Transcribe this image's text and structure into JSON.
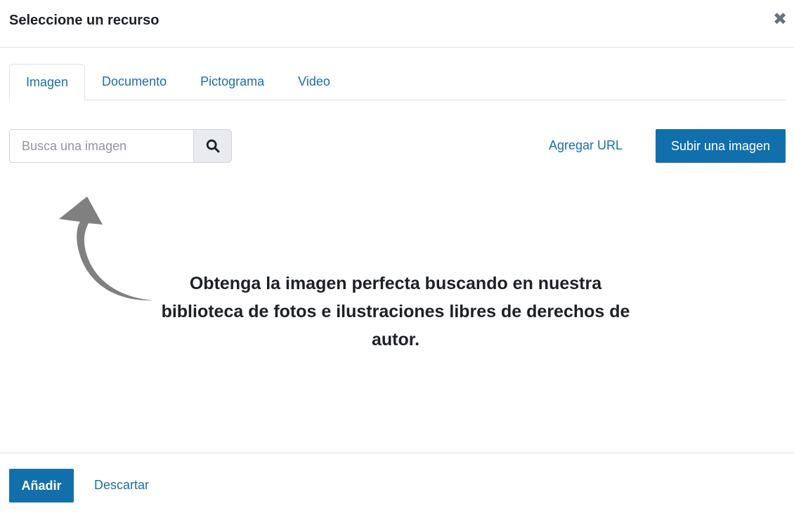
{
  "modal": {
    "title": "Seleccione un recurso",
    "close_icon": "close-icon"
  },
  "tabs": [
    {
      "label": "Imagen",
      "active": true
    },
    {
      "label": "Documento",
      "active": false
    },
    {
      "label": "Pictograma",
      "active": false
    },
    {
      "label": "Video",
      "active": false
    }
  ],
  "search": {
    "placeholder": "Busca una imagen",
    "value": "",
    "icon": "search-icon"
  },
  "actions": {
    "add_url_label": "Agregar URL",
    "upload_label": "Subir una imagen"
  },
  "hint": {
    "text": "Obtenga la imagen perfecta buscando en nuestra biblioteca de fotos e ilustraciones libres de derechos de autor.",
    "arrow_icon": "curved-arrow-up-icon"
  },
  "footer": {
    "add_label": "Añadir",
    "discard_label": "Descartar"
  },
  "colors": {
    "primary": "#1170ab",
    "link": "#1a6ea8",
    "text": "#1d2125",
    "arrow": "#808080"
  }
}
